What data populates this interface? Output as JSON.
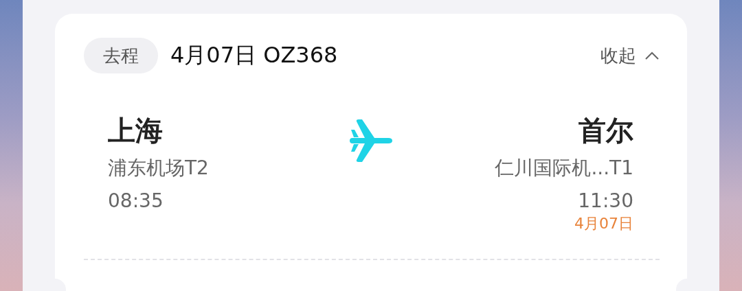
{
  "trip": {
    "label": "去程",
    "title": "4月07日 OZ368",
    "toggle": "收起",
    "expanded": true
  },
  "departure": {
    "city": "上海",
    "airport": "浦东机场T2",
    "time": "08:35"
  },
  "arrival": {
    "city": "首尔",
    "airport": "仁川国际机...T1",
    "time": "11:30",
    "date_note": "4月07日"
  }
}
